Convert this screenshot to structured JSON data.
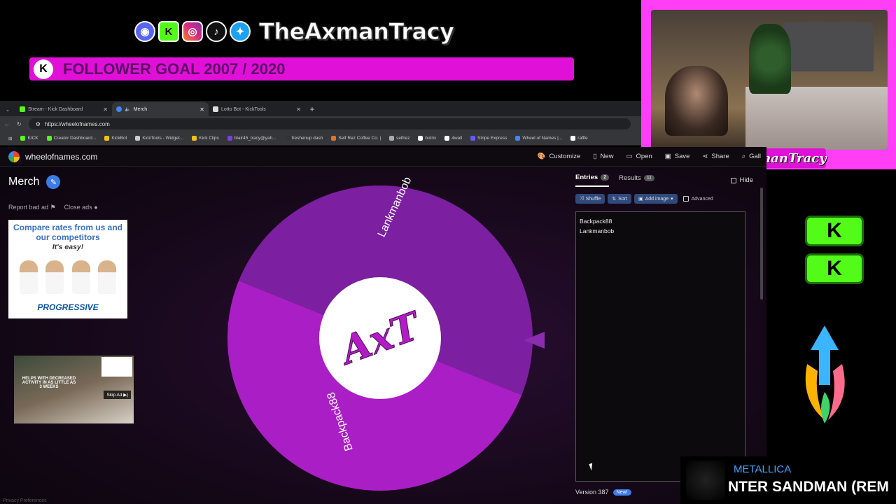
{
  "overlay": {
    "handle": "TheAxmanTracy",
    "goal_text": "FOLLOWER GOAL 2007 / 2020",
    "goal_k": "K",
    "cam_name": "TheAxmanTracy",
    "kick_letter": "K",
    "now_playing": {
      "artist": "METALLICA",
      "song": "NTER SANDMAN (REM"
    },
    "accent_color": "#e010d8"
  },
  "browser": {
    "tabs": [
      {
        "label": "Stream - Kick Dashboard",
        "active": false
      },
      {
        "label": "Merch",
        "active": true
      },
      {
        "label": "Lotto Bot - KickTools",
        "active": false
      }
    ],
    "url": "https://wheelofnames.com",
    "bookmarks": [
      "KICK",
      "Creator Dashboard...",
      "KickBot",
      "KickTools - Widget...",
      "Kick Clips",
      "blair45_tracy@yah...",
      "freshenup dash",
      "Self Rez Coffee Co. |",
      "selfrez",
      "botrix",
      "4wall",
      "Stripe Express",
      "Wheel of Names |...",
      "raffle"
    ]
  },
  "site": {
    "name": "wheelofnames.com",
    "nav": [
      "Customize",
      "New",
      "Open",
      "Save",
      "Share",
      "Gall"
    ],
    "wheel_title": "Merch",
    "report_ad": "Report bad ad",
    "close_ads": "Close ads",
    "ad1": {
      "headline": "Compare rates from us and our competitors",
      "sub": "It's easy!",
      "brand": "PROGRESSIVE"
    },
    "ad2": {
      "text": "HELPS WITH DECREASED ACTIVITY IN AS LITTLE AS 3 WEEKS",
      "skip": "Skip Ad ▶|"
    },
    "wheel_center": "AxT",
    "segments": [
      "Lankmanbob",
      "Backpack88"
    ]
  },
  "panel": {
    "tab_entries": "Entries",
    "entries_count": "2",
    "tab_results": "Results",
    "results_count": "11",
    "hide_label": "Hide",
    "tools": [
      "Shuffle",
      "Sort",
      "Add image"
    ],
    "advanced": "Advanced",
    "entries": [
      "Backpack88",
      "Lankmanbob"
    ],
    "version": "Version 387",
    "new_badge": "New!"
  },
  "footer": {
    "privacy": "Privacy Preferences"
  }
}
